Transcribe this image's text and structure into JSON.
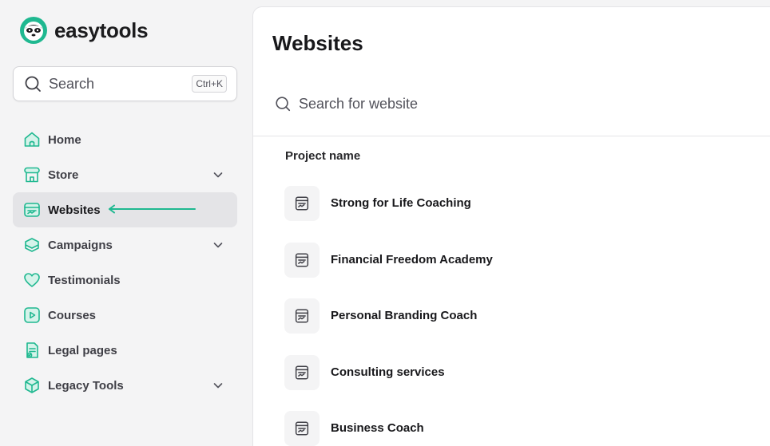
{
  "brand": {
    "name": "easytools",
    "accent": "#1fb890"
  },
  "sidebar": {
    "search": {
      "label": "Search",
      "shortcut": "Ctrl+K",
      "icon": "search-icon"
    },
    "items": [
      {
        "label": "Home",
        "icon": "home-icon",
        "expandable": false,
        "active": false
      },
      {
        "label": "Store",
        "icon": "store-icon",
        "expandable": true,
        "active": false
      },
      {
        "label": "Websites",
        "icon": "website-icon",
        "expandable": false,
        "active": true
      },
      {
        "label": "Campaigns",
        "icon": "campaigns-icon",
        "expandable": true,
        "active": false
      },
      {
        "label": "Testimonials",
        "icon": "heart-icon",
        "expandable": false,
        "active": false
      },
      {
        "label": "Courses",
        "icon": "play-icon",
        "expandable": false,
        "active": false
      },
      {
        "label": "Legal pages",
        "icon": "legal-document-icon",
        "expandable": false,
        "active": false
      },
      {
        "label": "Legacy Tools",
        "icon": "box-icon",
        "expandable": true,
        "active": false
      }
    ]
  },
  "main": {
    "title": "Websites",
    "search_placeholder": "Search for website",
    "column_header": "Project name",
    "projects": [
      {
        "name": "Strong for Life Coaching"
      },
      {
        "name": "Financial Freedom Academy"
      },
      {
        "name": "Personal Branding Coach"
      },
      {
        "name": "Consulting services"
      },
      {
        "name": "Business Coach"
      }
    ]
  }
}
